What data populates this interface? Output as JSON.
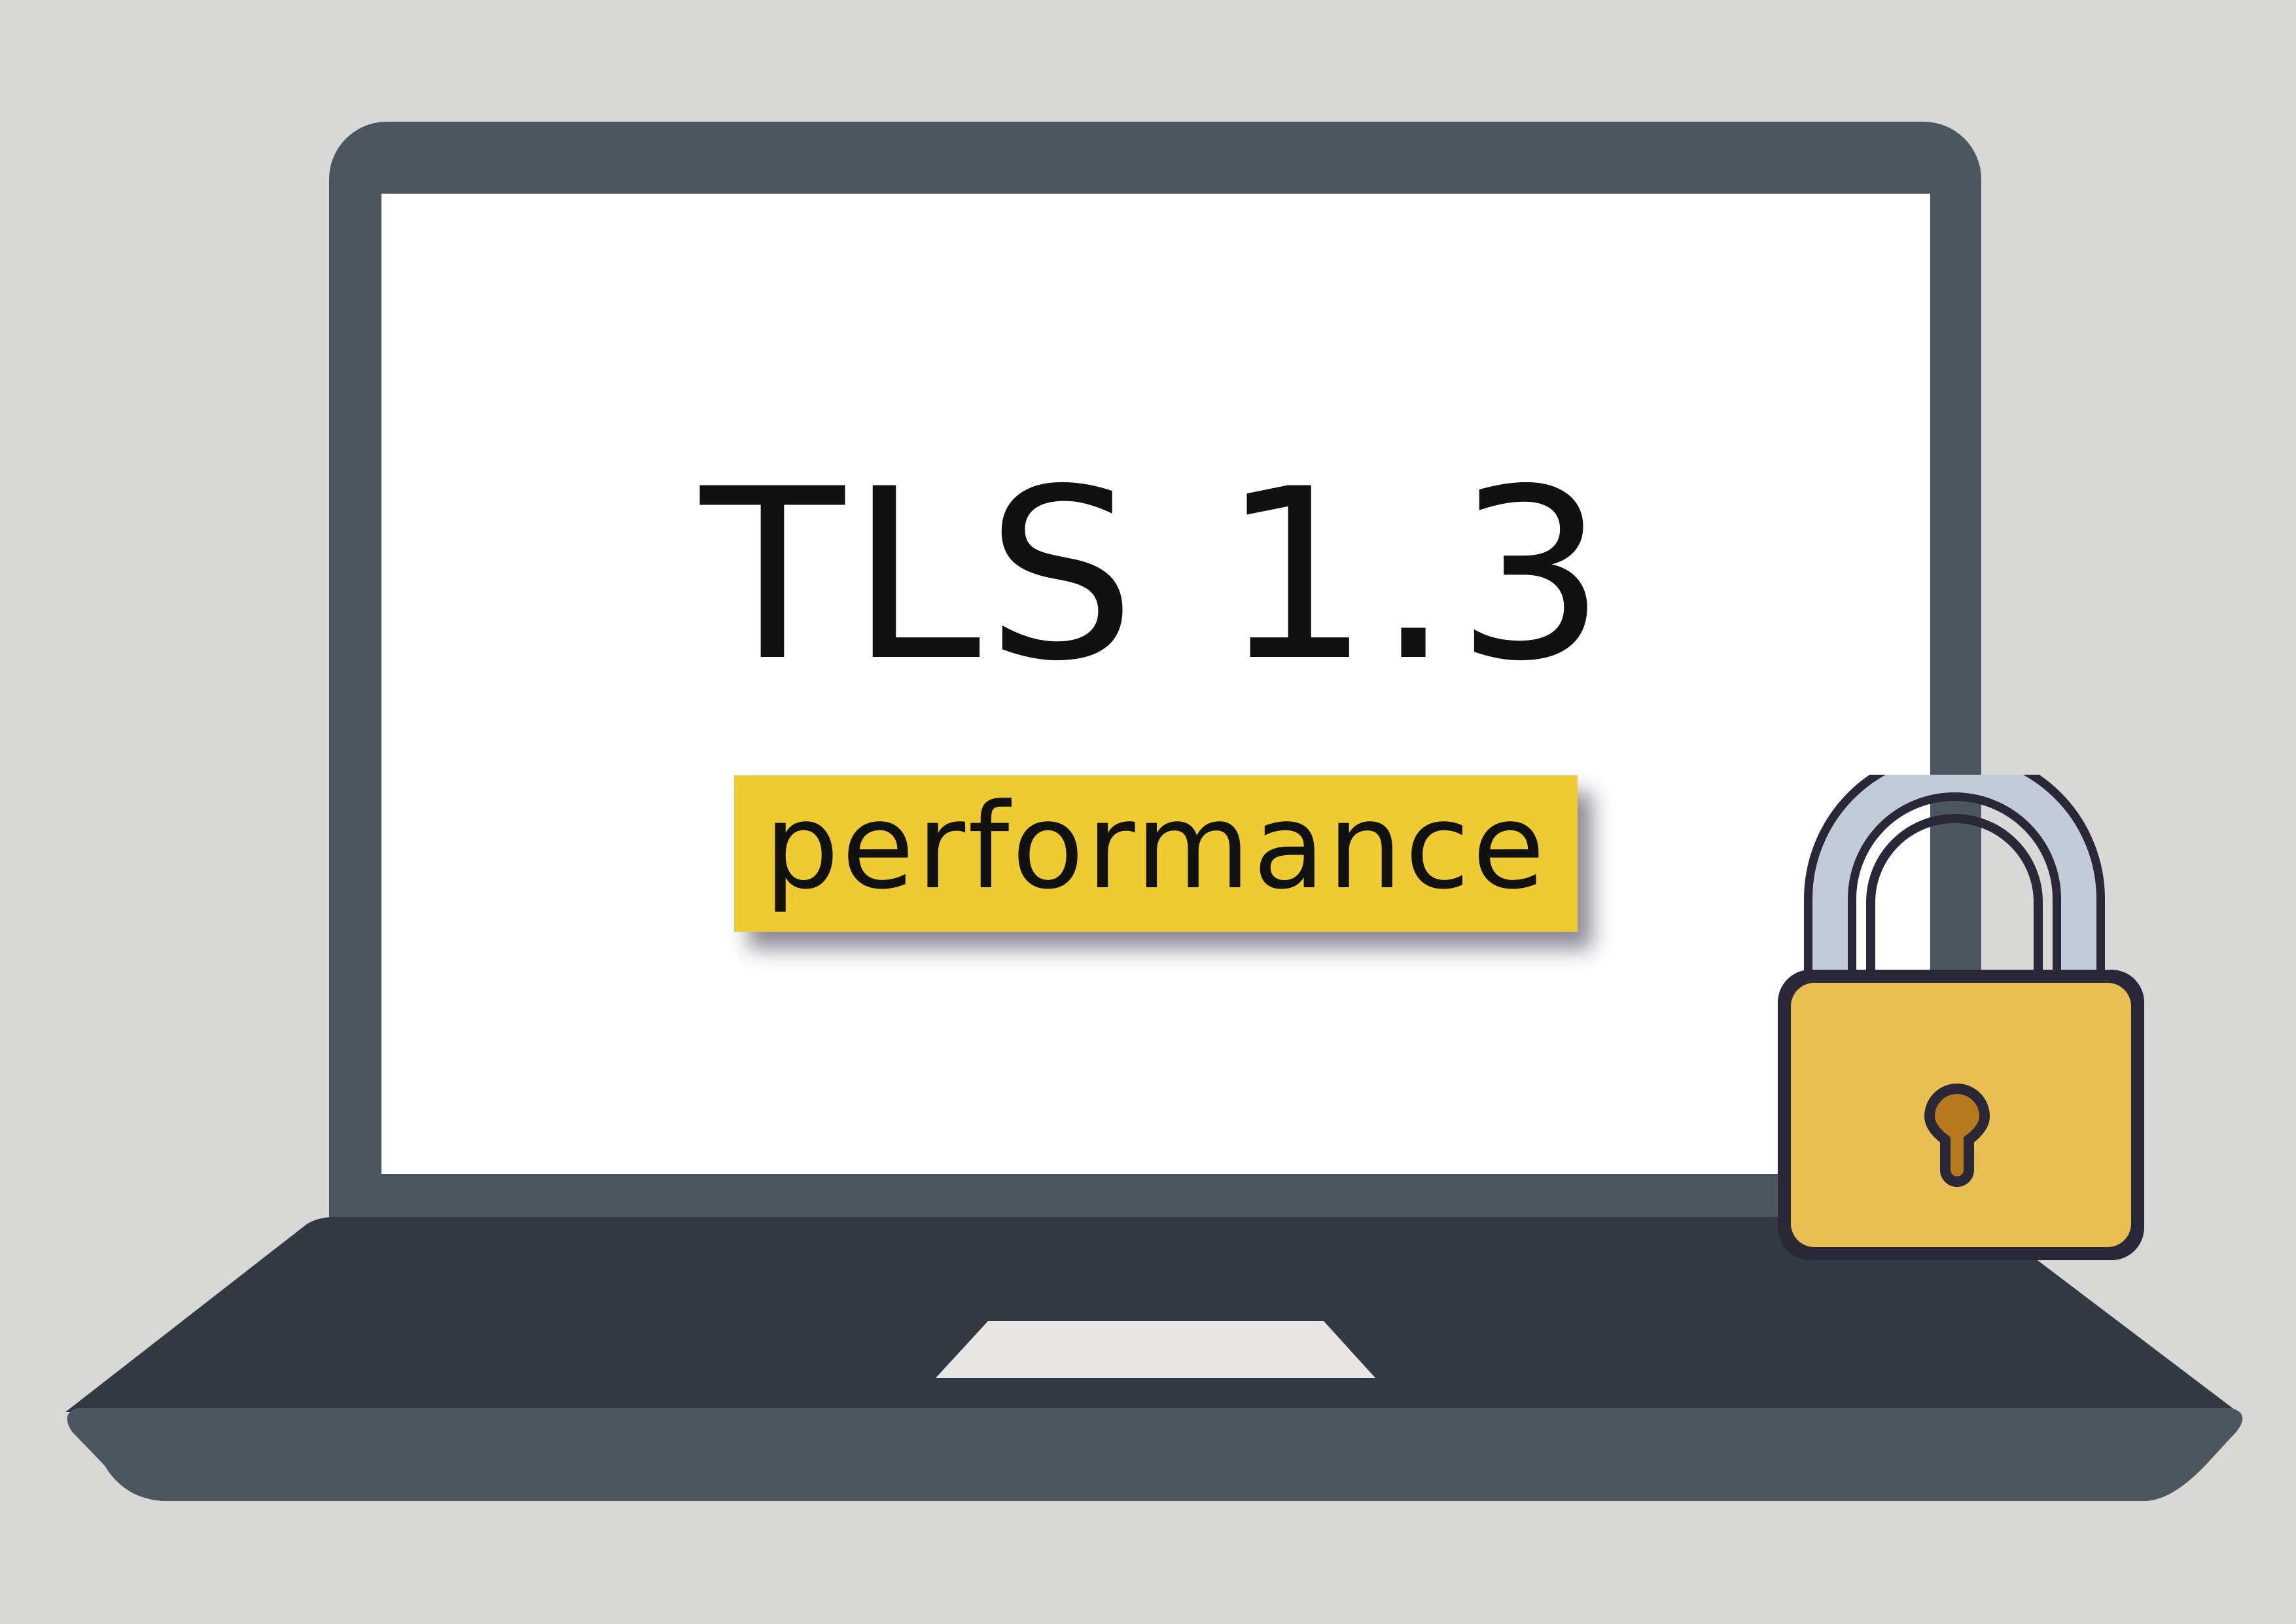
{
  "headline": "TLS 1.3",
  "tag": {
    "label": "performance",
    "color": "#edcb31"
  },
  "icons": {
    "laptop": "laptop-icon",
    "padlock": "padlock-icon",
    "keyhole": "keyhole-icon"
  },
  "colors": {
    "background": "#d8d8d6",
    "bezel": "#4b565f",
    "keyboard_deck": "#333942",
    "trackpad": "#e8e6e4",
    "lock_body": "#e9bf54",
    "lock_shackle": "#c2cbd8",
    "lock_outline": "#2a2838",
    "keyhole": "#b67a1c"
  }
}
